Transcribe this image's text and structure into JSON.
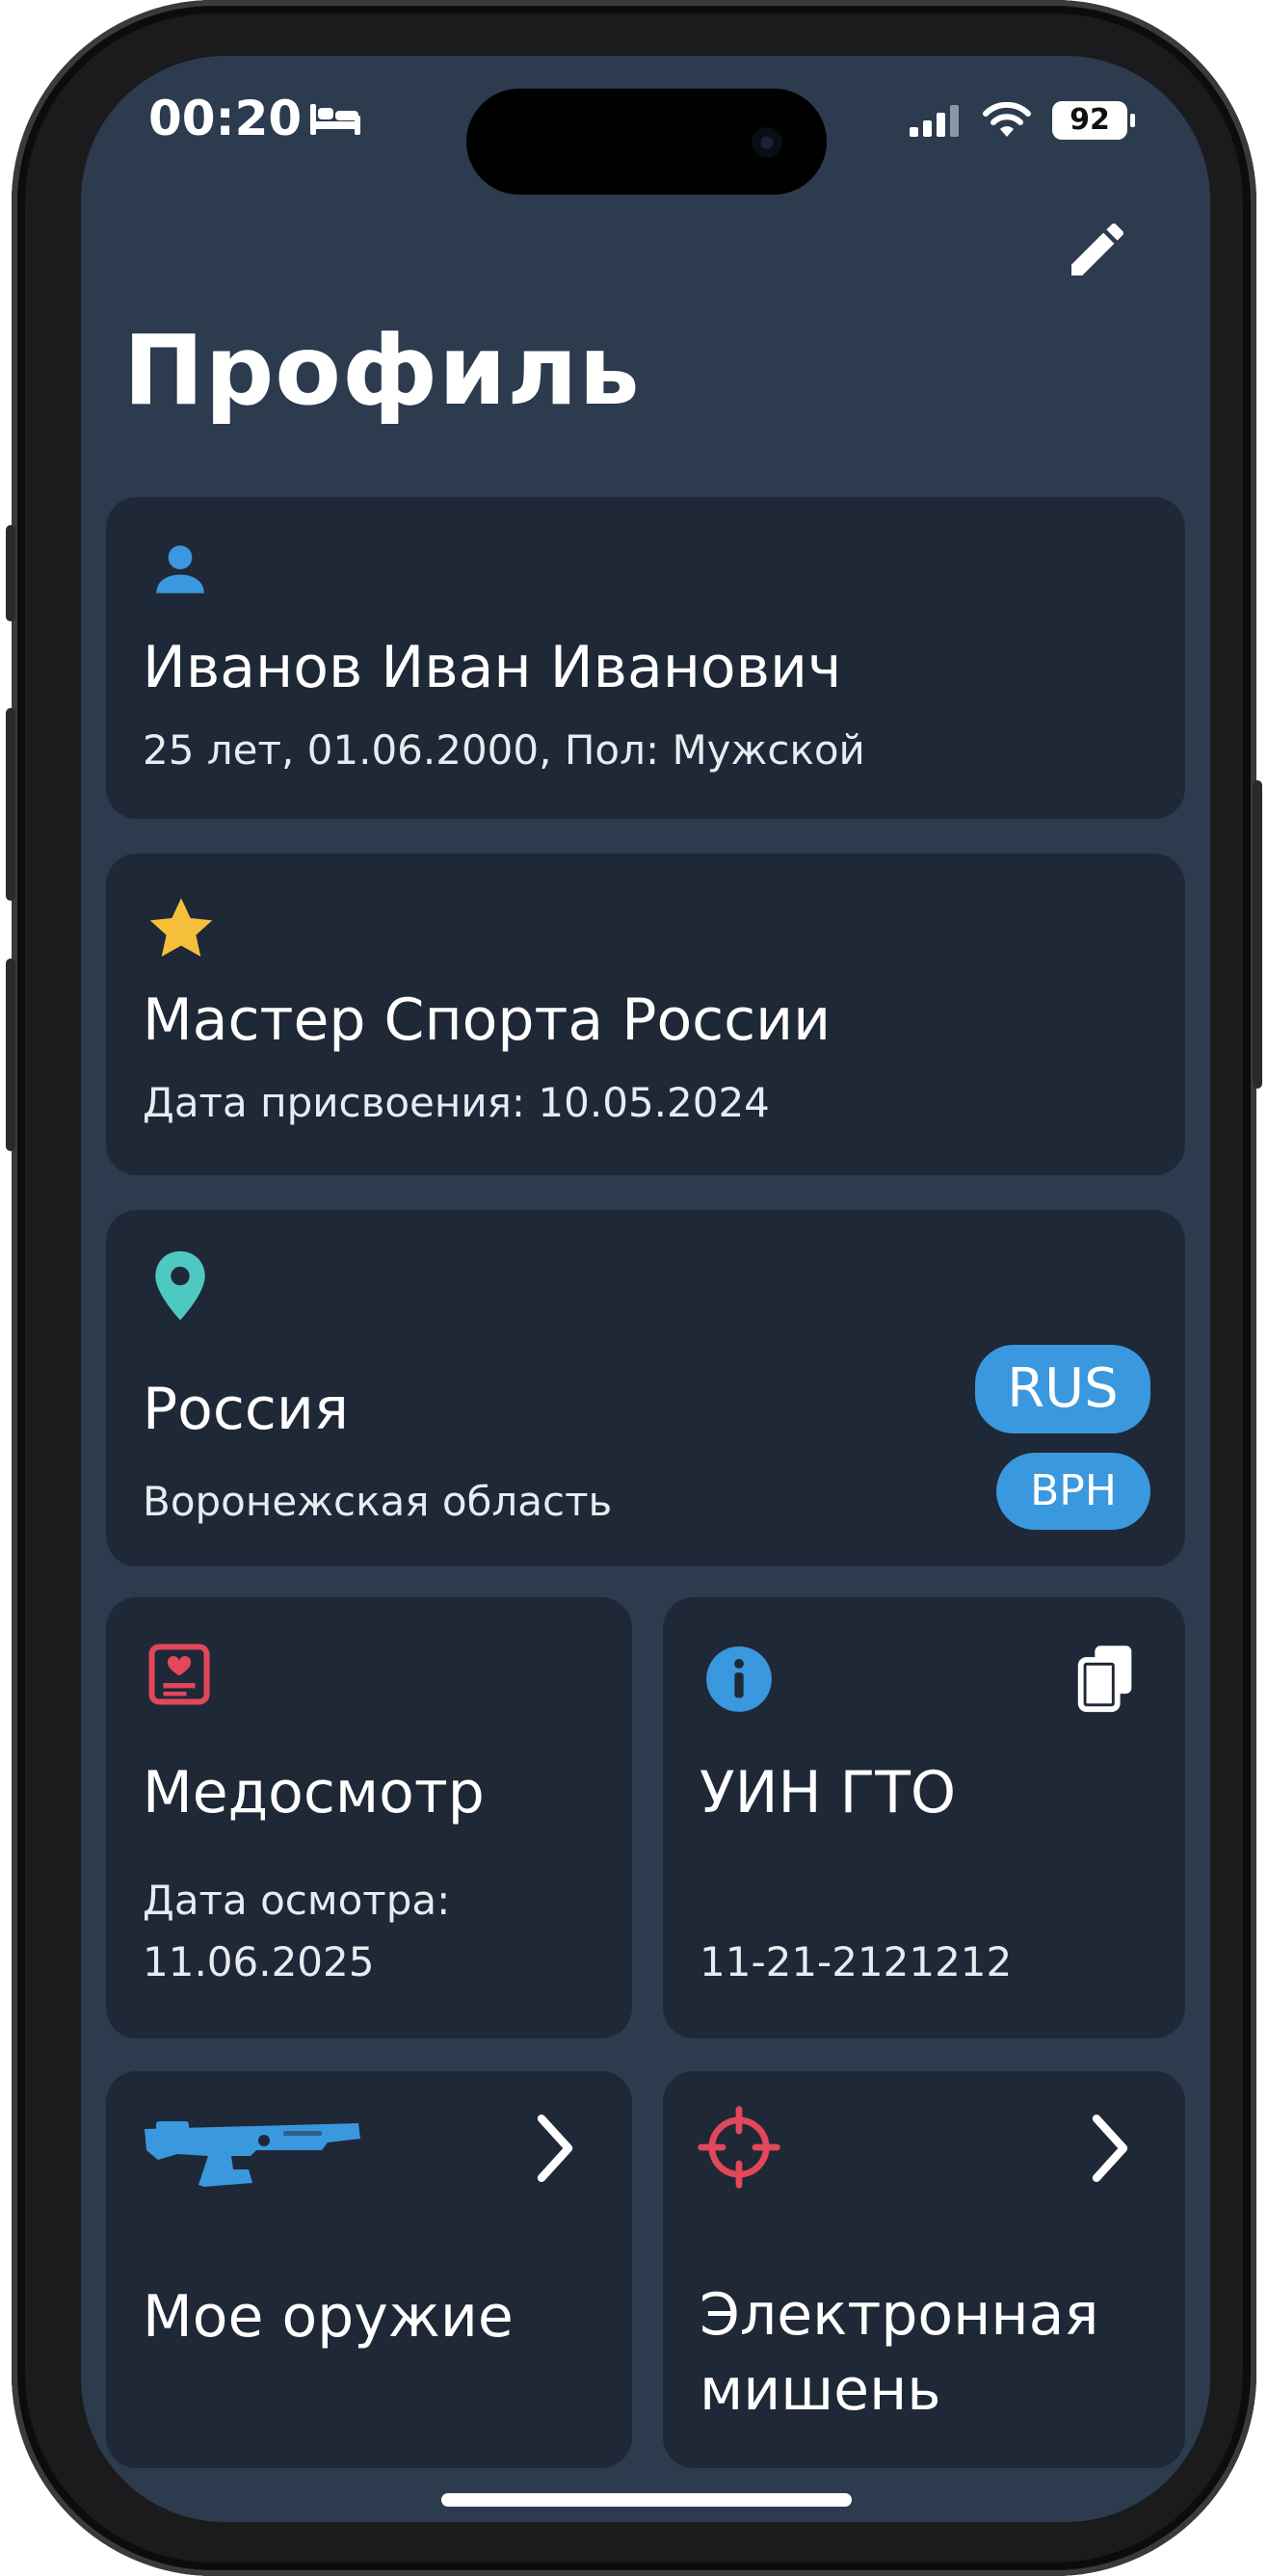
{
  "status_bar": {
    "time": "00:20",
    "battery": "92"
  },
  "header": {
    "title": "Профиль"
  },
  "profile": {
    "name": "Иванов Иван Иванович",
    "details": "25 лет, 01.06.2000, Пол: Мужской"
  },
  "rank": {
    "title": "Мастер Спорта России",
    "date": "Дата присвоения: 10.05.2024"
  },
  "location": {
    "country": "Россия",
    "region": "Воронежская область",
    "country_code": "RUS",
    "region_code": "ВРН"
  },
  "medical": {
    "title": "Медосмотр",
    "date_label": "Дата осмотра:",
    "date": "11.06.2025"
  },
  "gto": {
    "title": "УИН ГТО",
    "number": "11-21-2121212"
  },
  "weapons": {
    "title": "Мое оружие"
  },
  "target": {
    "title_line1": "Электронная",
    "title_line2": "мишень"
  },
  "colors": {
    "background": "#2c3b4e",
    "card": "#1f2836",
    "accent_blue": "#3a98de",
    "star": "#f5bf3b",
    "pin": "#4ec9c1",
    "red_icon": "#e2475a"
  }
}
